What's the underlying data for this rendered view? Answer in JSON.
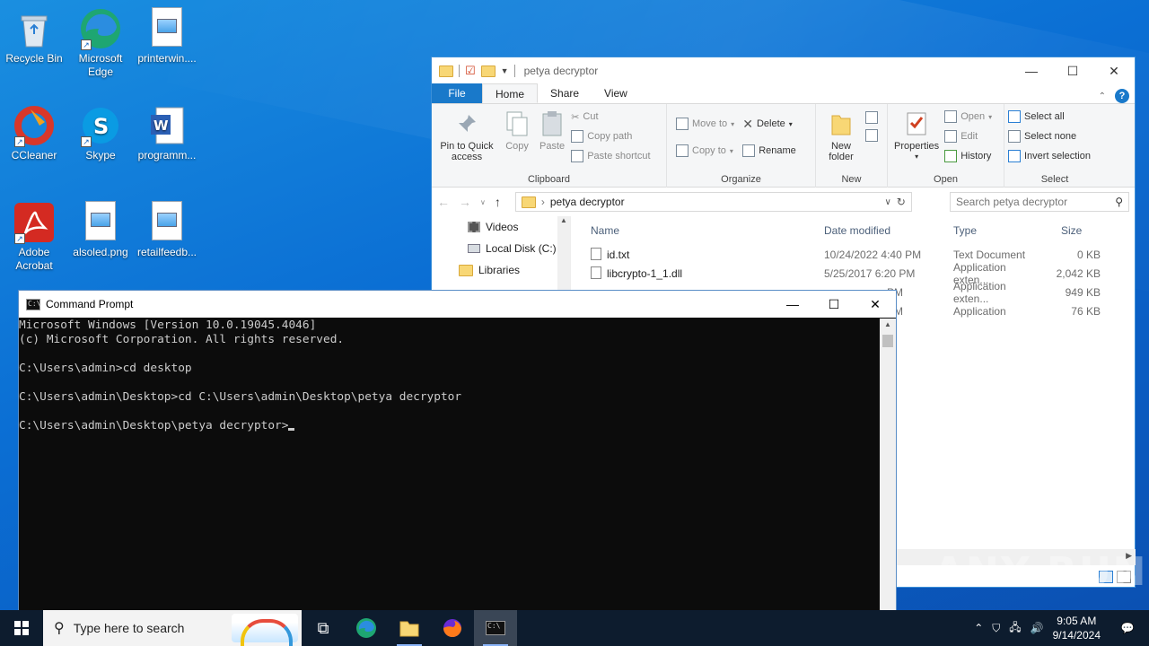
{
  "desktop": {
    "icons": [
      {
        "label": "Recycle Bin"
      },
      {
        "label": "Microsoft Edge"
      },
      {
        "label": "printerwin...."
      },
      {
        "label": "CCleaner"
      },
      {
        "label": "Skype"
      },
      {
        "label": "programm..."
      },
      {
        "label": "Adobe Acrobat"
      },
      {
        "label": "alsoled.png"
      },
      {
        "label": "retailfeedb..."
      }
    ]
  },
  "explorer": {
    "title": "petya decryptor",
    "tabs": [
      "File",
      "Home",
      "Share",
      "View"
    ],
    "ribbon": {
      "clipboard": {
        "pin": "Pin to Quick access",
        "copy": "Copy",
        "paste": "Paste",
        "cut": "Cut",
        "copy_path": "Copy path",
        "paste_shortcut": "Paste shortcut",
        "group": "Clipboard"
      },
      "organize": {
        "move_to": "Move to",
        "copy_to": "Copy to",
        "delete": "Delete",
        "rename": "Rename",
        "group": "Organize"
      },
      "new": {
        "new_folder": "New folder",
        "group": "New"
      },
      "open": {
        "properties": "Properties",
        "open": "Open",
        "edit": "Edit",
        "history": "History",
        "group": "Open"
      },
      "select": {
        "select_all": "Select all",
        "select_none": "Select none",
        "invert": "Invert selection",
        "group": "Select"
      }
    },
    "address": {
      "path": "petya decryptor",
      "search_placeholder": "Search petya decryptor"
    },
    "nav": [
      "Videos",
      "Local Disk (C:)",
      "Libraries"
    ],
    "columns": {
      "name": "Name",
      "date": "Date modified",
      "type": "Type",
      "size": "Size"
    },
    "files": [
      {
        "name": "id.txt",
        "date": "10/24/2022 4:40 PM",
        "type": "Text Document",
        "size": "0 KB"
      },
      {
        "name": "libcrypto-1_1.dll",
        "date": "5/25/2017 6:20 PM",
        "type": "Application exten...",
        "size": "2,042 KB"
      },
      {
        "name": "",
        "date": "PM",
        "type": "Application exten...",
        "size": "949 KB"
      },
      {
        "name": "",
        "date": "PM",
        "type": "Application",
        "size": "76 KB"
      }
    ]
  },
  "cmd": {
    "title": "Command Prompt",
    "lines": [
      "Microsoft Windows [Version 10.0.19045.4046]",
      "(c) Microsoft Corporation. All rights reserved.",
      "",
      "C:\\Users\\admin>cd desktop",
      "",
      "C:\\Users\\admin\\Desktop>cd C:\\Users\\admin\\Desktop\\petya decryptor",
      "",
      "C:\\Users\\admin\\Desktop\\petya decryptor>"
    ]
  },
  "taskbar": {
    "search_placeholder": "Type here to search",
    "time": "9:05 AM",
    "date": "9/14/2024"
  },
  "watermark": "ANY RUN"
}
